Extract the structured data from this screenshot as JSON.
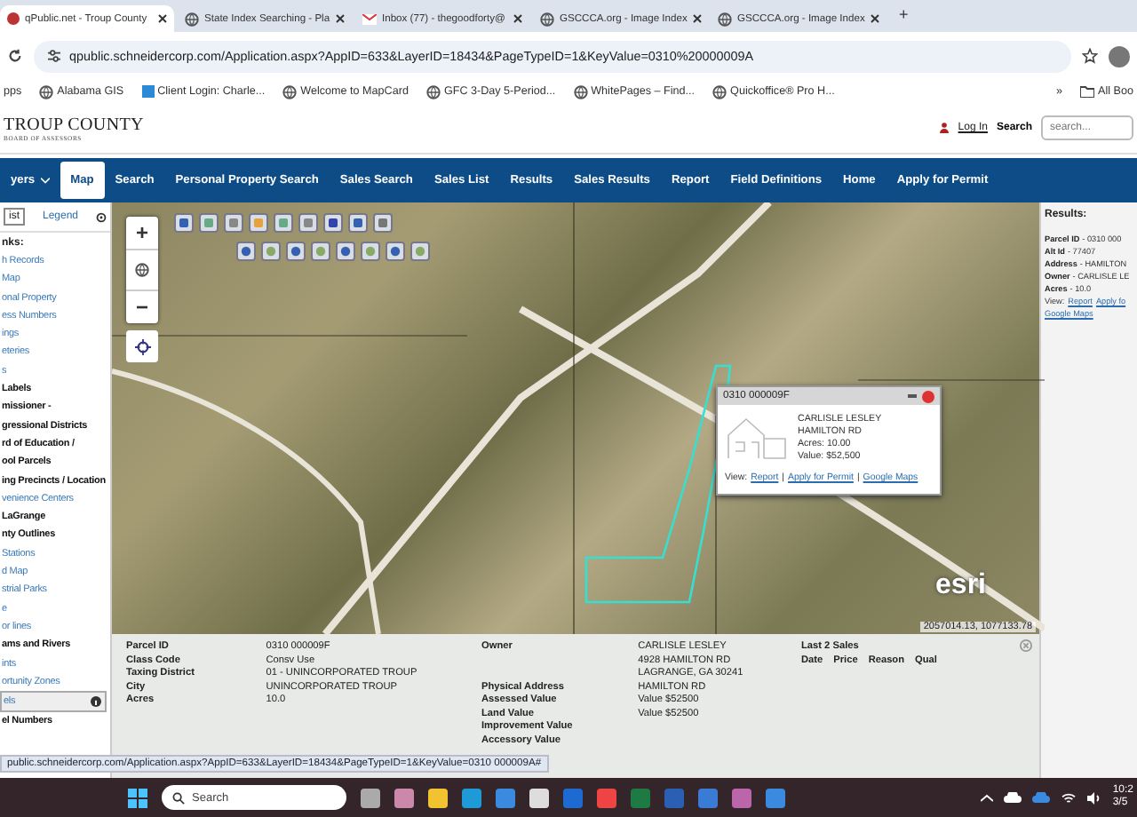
{
  "browser": {
    "tabs": [
      {
        "title": "qPublic.net - Troup County",
        "selected": true
      },
      {
        "title": "State Index Searching - Pla",
        "selected": false
      },
      {
        "title": "Inbox (77) - thegoodforty@",
        "selected": false
      },
      {
        "title": "GSCCCA.org - Image Index",
        "selected": false
      },
      {
        "title": "GSCCCA.org - Image Index",
        "selected": false
      }
    ],
    "new_tab": "+",
    "url": "qpublic.schneidercorp.com/Application.aspx?AppID=633&LayerID=18434&PageTypeID=1&KeyValue=0310%20000009A",
    "bookmarks": [
      "pps",
      "Alabama GIS",
      "Client Login: Charle...",
      "Welcome to MapCard",
      "GFC 3-Day 5-Period...",
      "WhitePages – Find...",
      "Quickoffice® Pro H..."
    ],
    "bookmarks_more": "»",
    "all_bookmarks": "All Boo"
  },
  "header": {
    "title": "TROUP COUNTY",
    "subtitle": "BOARD OF ASSESSORS",
    "login": "Log In",
    "search_label": "Search",
    "search_placeholder": "search..."
  },
  "nav": [
    {
      "label": "yers",
      "kind": "dropdown",
      "selected": false
    },
    {
      "label": "Map",
      "kind": "link",
      "selected": true
    },
    {
      "label": "Search",
      "kind": "link",
      "selected": false
    },
    {
      "label": "Personal Property Search",
      "kind": "link",
      "selected": false
    },
    {
      "label": "Sales Search",
      "kind": "link",
      "selected": false
    },
    {
      "label": "Sales List",
      "kind": "link",
      "selected": false
    },
    {
      "label": "Results",
      "kind": "link",
      "selected": false
    },
    {
      "label": "Sales Results",
      "kind": "link",
      "selected": false
    },
    {
      "label": "Report",
      "kind": "link",
      "selected": false
    },
    {
      "label": "Field Definitions",
      "kind": "link",
      "selected": false
    },
    {
      "label": "Home",
      "kind": "link",
      "selected": false
    },
    {
      "label": "Apply for Permit",
      "kind": "link",
      "selected": false
    }
  ],
  "sidebar": {
    "tabs": [
      {
        "label": "ist",
        "selected": true
      },
      {
        "label": "Legend",
        "selected": false
      }
    ],
    "heading": "nks:",
    "items": [
      {
        "label": "h Records",
        "kind": "link"
      },
      {
        "label": "Map",
        "kind": "link"
      },
      {
        "label": "onal Property",
        "kind": "link"
      },
      {
        "label": "ess Numbers",
        "kind": "link"
      },
      {
        "label": "ings",
        "kind": "link"
      },
      {
        "label": "eteries",
        "kind": "link"
      },
      {
        "label": "s",
        "kind": "link"
      },
      {
        "label": "Labels",
        "kind": "layer"
      },
      {
        "label": "missioner -",
        "kind": "layer"
      },
      {
        "label": "gressional Districts",
        "kind": "layer"
      },
      {
        "label": "rd of Education /",
        "kind": "layer"
      },
      {
        "label": "ool Parcels",
        "kind": "layer"
      },
      {
        "label": "ing Precincts / Location",
        "kind": "layer"
      },
      {
        "label": "venience Centers",
        "kind": "link"
      },
      {
        "label": "LaGrange",
        "kind": "layer"
      },
      {
        "label": "nty Outlines",
        "kind": "layer"
      },
      {
        "label": "Stations",
        "kind": "link"
      },
      {
        "label": "d Map",
        "kind": "link"
      },
      {
        "label": "strial Parks",
        "kind": "link"
      },
      {
        "label": "e",
        "kind": "link"
      },
      {
        "label": "or lines",
        "kind": "link"
      },
      {
        "label": "ams and Rivers",
        "kind": "layer"
      },
      {
        "label": "ints",
        "kind": "link"
      },
      {
        "label": "ortunity Zones",
        "kind": "link"
      },
      {
        "label": "els",
        "kind": "active"
      },
      {
        "label": "el Numbers",
        "kind": "layer"
      }
    ]
  },
  "map": {
    "zoom_in": "+",
    "zoom_out": "−",
    "attribution": "esri",
    "coordinates": "2057014.13, 1077133.78",
    "popup": {
      "title": "0310 000009F",
      "lines": [
        "CARLISLE LESLEY",
        "HAMILTON RD",
        "Acres: 10.00",
        "Value: $52,500"
      ],
      "view_label": "View:",
      "links": [
        "Report",
        "Apply for Permit",
        "Google Maps"
      ],
      "separator": "|"
    }
  },
  "results": {
    "title": "Results:",
    "fields": [
      {
        "label": "Parcel ID",
        "value": "- 0310 000"
      },
      {
        "label": "Alt Id",
        "value": "- 77407"
      },
      {
        "label": "Address",
        "value": "- HAMILTON"
      },
      {
        "label": "Owner",
        "value": "- CARLISLE LE"
      },
      {
        "label": "Acres",
        "value": "- 10.0"
      }
    ],
    "view_label": "View:",
    "links": [
      "Report",
      "Apply fo",
      "Google Maps"
    ]
  },
  "details": {
    "left": [
      {
        "label": "Parcel ID",
        "values": [
          "0310 000009F"
        ]
      },
      {
        "label": "Class Code",
        "values": [
          "Consv Use"
        ]
      },
      {
        "label": "Taxing District",
        "values": [
          "01 - UNINCORPORATED TROUP"
        ]
      },
      {
        "label": "City",
        "values": [
          "UNINCORPORATED TROUP"
        ]
      },
      {
        "label": "Acres",
        "values": [
          "10.0"
        ]
      }
    ],
    "middle": [
      {
        "label": "Owner",
        "values": [
          "CARLISLE LESLEY",
          "4928 HAMILTON RD",
          "LAGRANGE, GA 30241"
        ]
      },
      {
        "label": "Physical Address",
        "values": [
          "HAMILTON RD"
        ]
      },
      {
        "label": "Assessed Value",
        "values": [
          "Value $52500"
        ]
      },
      {
        "label": "Land Value",
        "values": [
          "Value $52500"
        ]
      },
      {
        "label": "Improvement Value"
      },
      {
        "label": "Accessory Value"
      }
    ],
    "sales_title": "Last 2 Sales",
    "sales_columns": [
      "Date",
      "Price",
      "Reason",
      "Qual"
    ]
  },
  "status_url": "public.schneidercorp.com/Application.aspx?AppID=633&LayerID=18434&PageTypeID=1&KeyValue=0310 000009A#",
  "taskbar": {
    "search_placeholder": "Search",
    "time": "10:2",
    "date": "3/5"
  }
}
